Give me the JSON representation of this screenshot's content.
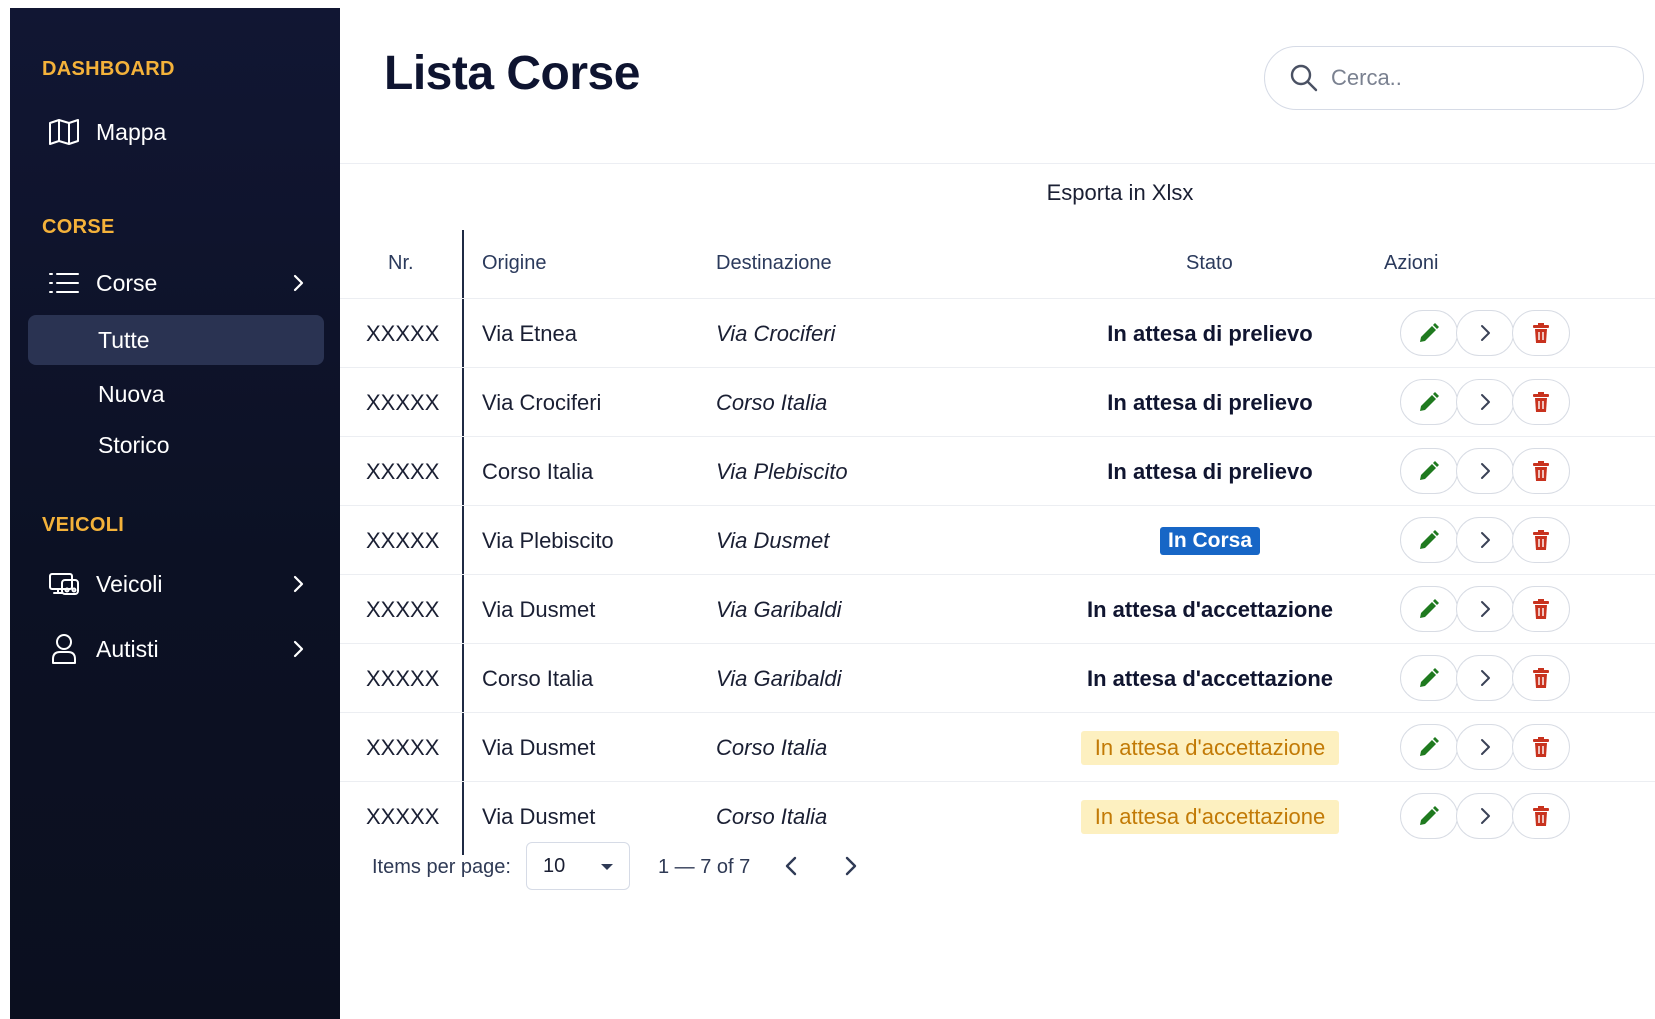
{
  "sidebar": {
    "sections": {
      "dashboard": "DASHBOARD",
      "corse": "CORSE",
      "veicoli": "VEICOLI"
    },
    "items": {
      "mappa": "Mappa",
      "corse": "Corse",
      "veicoli": "Veicoli",
      "autisti": "Autisti"
    },
    "subitems": {
      "tutte": "Tutte",
      "nuova": "Nuova",
      "storico": "Storico"
    }
  },
  "header": {
    "title": "Lista Corse",
    "search_placeholder": "Cerca.."
  },
  "export_label": "Esporta in Xlsx",
  "table": {
    "headers": {
      "nr": "Nr.",
      "origin": "Origine",
      "destination": "Destinazione",
      "status": "Stato",
      "actions": "Azioni"
    },
    "rows": [
      {
        "nr": "XXXXX",
        "origin": "Via Etnea",
        "destination": "Via Crociferi",
        "status": "In attesa di prelievo",
        "style": "bold"
      },
      {
        "nr": "XXXXX",
        "origin": "Via Crociferi",
        "destination": "Corso Italia",
        "status": "In attesa di prelievo",
        "style": "bold"
      },
      {
        "nr": "XXXXX",
        "origin": "Corso Italia",
        "destination": "Via Plebiscito",
        "status": "In attesa di prelievo",
        "style": "bold"
      },
      {
        "nr": "XXXXX",
        "origin": "Via Plebiscito",
        "destination": "Via Dusmet",
        "status": "In Corsa",
        "style": "blue"
      },
      {
        "nr": "XXXXX",
        "origin": "Via Dusmet",
        "destination": "Via Garibaldi",
        "status": "In attesa d'accettazione",
        "style": "bold"
      },
      {
        "nr": "XXXXX",
        "origin": "Corso Italia",
        "destination": "Via Garibaldi",
        "status": "In attesa d'accettazione",
        "style": "bold"
      },
      {
        "nr": "XXXXX",
        "origin": "Via Dusmet",
        "destination": "Corso Italia",
        "status": "In attesa d'accettazione",
        "style": "yellow"
      },
      {
        "nr": "XXXXX",
        "origin": "Via Dusmet",
        "destination": "Corso Italia",
        "status": "In attesa d'accettazione",
        "style": "yellow"
      }
    ]
  },
  "pagination": {
    "items_label": "Items per page:",
    "page_size": "10",
    "range": "1 — 7 of 7"
  },
  "colors": {
    "sidebar_bg": "#0c1124",
    "section_title": "#f4b23a",
    "active_item": "#2a3352",
    "edit_icon": "#1f7a1f",
    "delete_icon": "#c8321e",
    "status_blue": "#1766c6",
    "status_yellow_bg": "#fdf0c0",
    "status_yellow_text": "#c27a06"
  },
  "icons": {
    "mappa": "map-icon",
    "corse": "list-icon",
    "veicoli": "vehicle-icon",
    "autisti": "user-icon",
    "search": "search-icon",
    "edit": "pencil-icon",
    "detail": "chevron-right-icon",
    "delete": "trash-icon"
  }
}
